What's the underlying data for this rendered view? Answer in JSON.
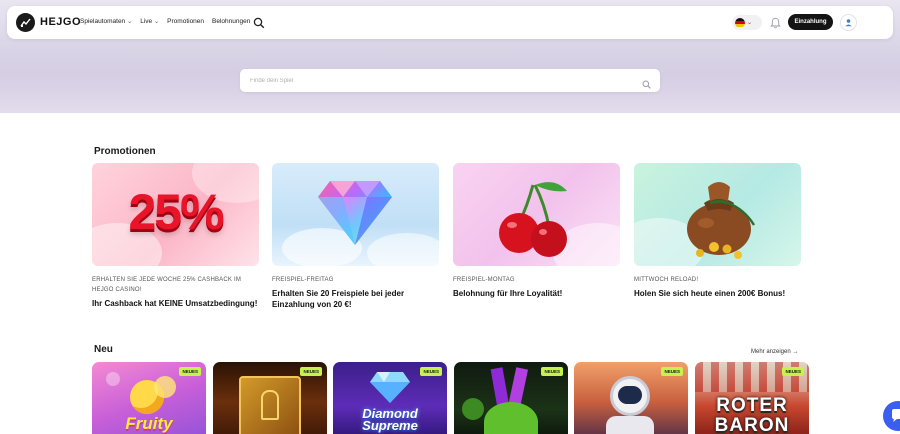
{
  "header": {
    "logo_text": "HEJGO",
    "nav": [
      {
        "label": "Spielautomaten",
        "has_dropdown": true
      },
      {
        "label": "Live",
        "has_dropdown": true
      },
      {
        "label": "Promotionen",
        "has_dropdown": false
      },
      {
        "label": "Belohnungen",
        "has_dropdown": false
      }
    ],
    "language": "de",
    "login_label": "Einzahlung"
  },
  "search": {
    "placeholder": "Finde dein Spiel"
  },
  "promotions": {
    "title": "Promotionen",
    "items": [
      {
        "image_text": "25%",
        "tag": "ERHALTEN SIE JEDE WOCHE 25% CASHBACK IM HEJGO CASINO!",
        "title": "Ihr Cashback hat KEINE Umsatzbedingung!"
      },
      {
        "image_text": "",
        "tag": "FREISPIEL-FREITAG",
        "title": "Erhalten Sie 20 Freispiele bei jeder Einzahlung von 20 €!"
      },
      {
        "image_text": "",
        "tag": "FREISPIEL-MONTAG",
        "title": "Belohnung für Ihre Loyalität!"
      },
      {
        "image_text": "",
        "tag": "MITTWOCH RELOAD!",
        "title": "Holen Sie sich heute einen 200€ Bonus!"
      }
    ]
  },
  "new_games": {
    "title": "Neu",
    "more_label": "Mehr anzeigen",
    "badge_label": "NEUES",
    "items": [
      {
        "name": "Fruity"
      },
      {
        "name": ""
      },
      {
        "name": "Diamond Supreme"
      },
      {
        "name": ""
      },
      {
        "name": ""
      },
      {
        "name": "ROTER BARON"
      }
    ]
  },
  "colors": {
    "accent": "#141414",
    "badge": "#c6f24a",
    "chat": "#3a5ff0"
  }
}
